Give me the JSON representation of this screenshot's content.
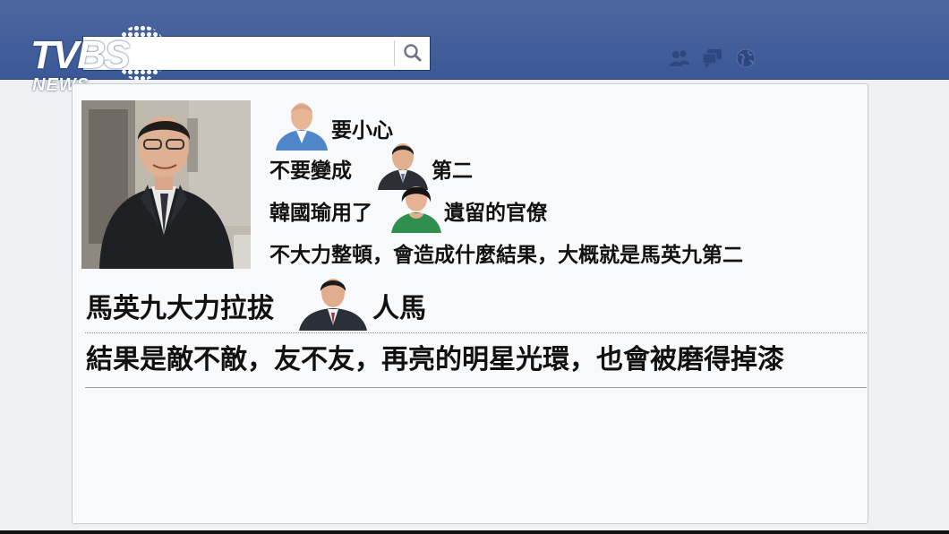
{
  "header": {
    "logo_main": "TVBS",
    "logo_sub": "NEWS",
    "search": {
      "value": "",
      "placeholder": ""
    },
    "nav_icons": [
      "friends-icon",
      "messages-icon",
      "globe-notifications-icon"
    ]
  },
  "post": {
    "line1": "要小心",
    "line2_left": "不要變成",
    "line2_right": "第二",
    "line3_left": "韓國瑜用了",
    "line3_right": "遺留的官僚",
    "line4": "不大力整頓，會造成什麼結果，大概就是馬英九第二",
    "line5_left": "馬英九大力拉拔",
    "line5_right": "人馬",
    "line6": "結果是敵不敵，友不友，再亮的明星光環，也會被磨得掉漆"
  },
  "colors": {
    "header": "#3b5897",
    "card": "#f8f9fb",
    "text": "#111111"
  }
}
